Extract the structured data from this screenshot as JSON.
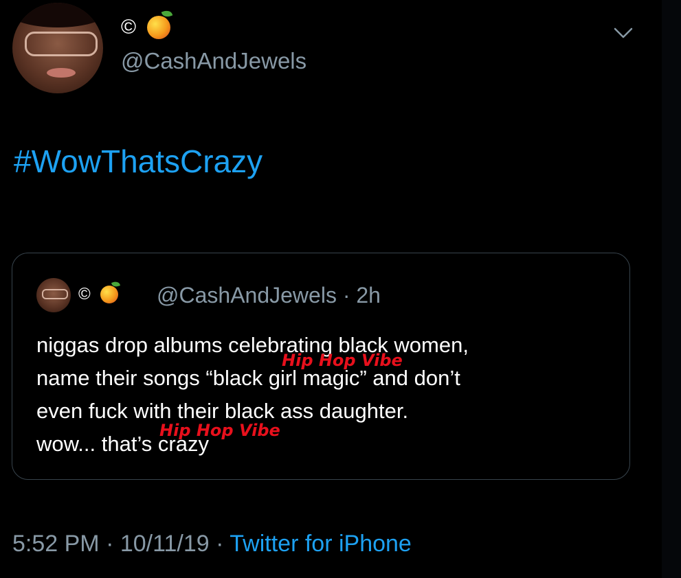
{
  "tweet": {
    "author": {
      "handle": "@CashAndJewels",
      "name_symbol": "©",
      "name_emoji_icon": "mango-icon"
    },
    "text": "#WowThatsCrazy",
    "menu_icon": "chevron-down-icon",
    "timestamp": "5:52 PM · 10/11/19",
    "separator": " · ",
    "source": "Twitter for iPhone"
  },
  "quoted_tweet": {
    "author": {
      "name_symbol": "©",
      "name_emoji_icon": "mango-icon"
    },
    "meta": "@CashAndJewels · 2h",
    "lines": [
      "niggas drop albums celebrating black women,",
      "name their songs “black girl magic” and don’t",
      "even fuck with their black ass daughter.",
      "wow... that’s crazy"
    ]
  },
  "watermarks": [
    "Hip Hop Vibe",
    "Hip Hop Vibe"
  ],
  "colors": {
    "background": "#000000",
    "link_blue": "#1da1f2",
    "secondary_text": "#8899a6",
    "card_border": "#38444d",
    "watermark_red": "#e8101c"
  }
}
